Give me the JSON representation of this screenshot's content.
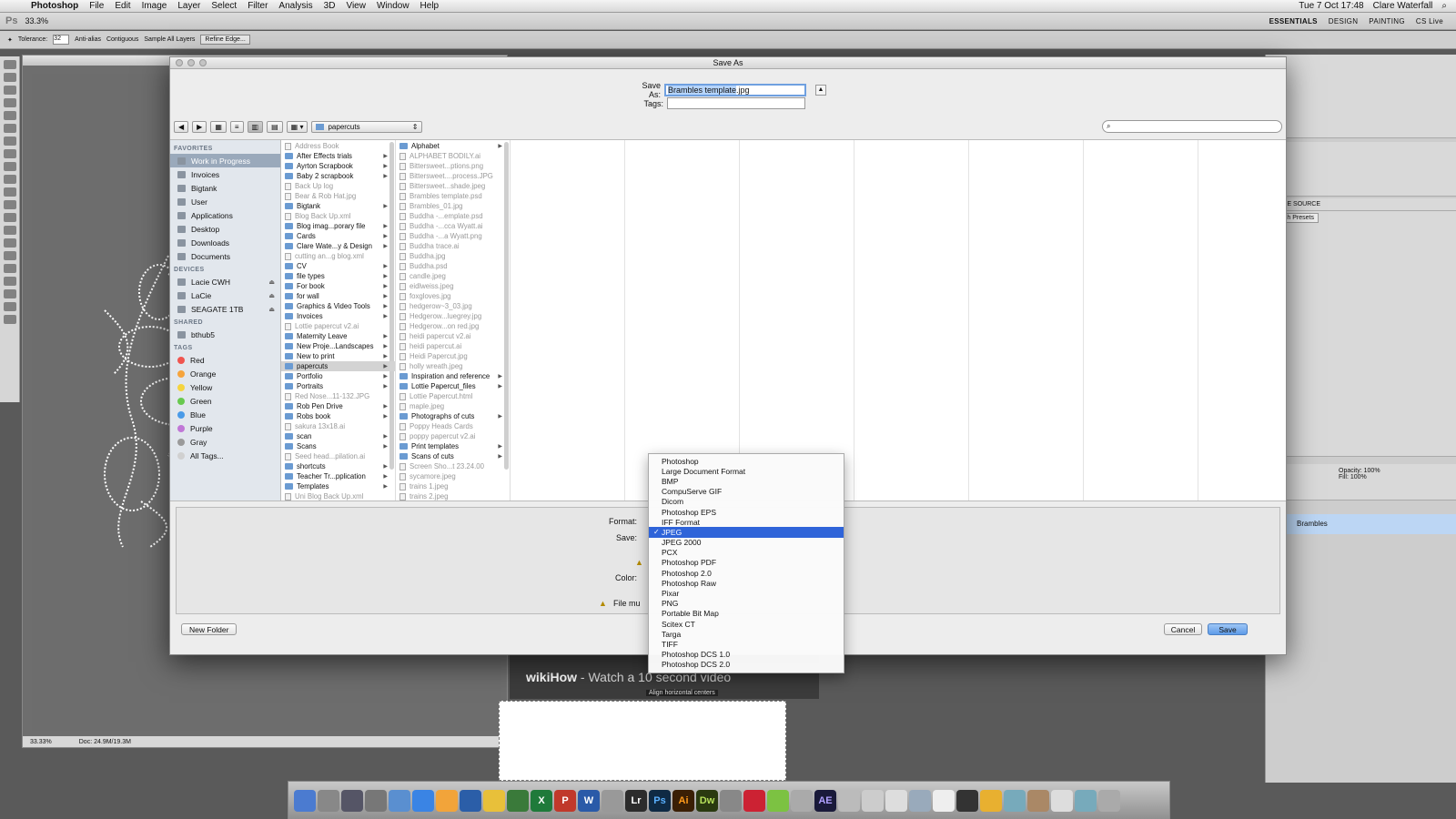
{
  "menubar": {
    "app": "Photoshop",
    "items": [
      "File",
      "Edit",
      "Image",
      "Layer",
      "Select",
      "Filter",
      "Analysis",
      "3D",
      "View",
      "Window",
      "Help"
    ],
    "clock": "Tue 7 Oct  17:48",
    "user": "Clare Waterfall"
  },
  "appbar": {
    "logo": "Ps",
    "zoom": "33.3%",
    "workspaces": [
      "ESSENTIALS",
      "DESIGN",
      "PAINTING"
    ],
    "cslive": "CS Live"
  },
  "optbar": {
    "tolerance_label": "Tolerance:",
    "tolerance_value": "32",
    "antialias": "Anti-alias",
    "contiguous": "Contiguous",
    "sample_all": "Sample All Layers",
    "refine": "Refine Edge..."
  },
  "docwin": {
    "zoom": "33.33%",
    "doc": "Doc: 24.9M/19.3M"
  },
  "rpanels": {
    "clone_source": "CLONE SOURCE",
    "brush_presets": "Brush Presets",
    "opacity_label": "Opacity:",
    "opacity_value": "100%",
    "fill_label": "Fill:",
    "fill_value": "100%",
    "layer_name": "Brambles"
  },
  "wiki": {
    "brand": "wikiHow",
    "text": " - Watch a 10 second video",
    "tooltip": "Align horizontal centers"
  },
  "dialog": {
    "title": "Save As",
    "save_as_label": "Save As:",
    "save_as_name": "Brambles template",
    "save_as_ext": ".jpg",
    "tags_label": "Tags:",
    "path_popup": "papercuts",
    "format_label": "Format:",
    "save_label": "Save:",
    "color_label": "Color:",
    "file_must": "File mu",
    "new_folder": "New Folder",
    "cancel": "Cancel",
    "save": "Save"
  },
  "sidebar": {
    "favorites_header": "FAVORITES",
    "favorites": [
      "Work in Progress",
      "Invoices",
      "Bigtank",
      "User",
      "Applications",
      "Desktop",
      "Downloads",
      "Documents"
    ],
    "devices_header": "DEVICES",
    "devices": [
      "Lacie CWH",
      "LaCie",
      "SEAGATE 1TB"
    ],
    "shared_header": "SHARED",
    "shared": [
      "bthub5"
    ],
    "tags_header": "TAGS",
    "tags": [
      {
        "name": "Red",
        "color": "#f0554f"
      },
      {
        "name": "Orange",
        "color": "#f6a43c"
      },
      {
        "name": "Yellow",
        "color": "#f5d43f"
      },
      {
        "name": "Green",
        "color": "#68c94f"
      },
      {
        "name": "Blue",
        "color": "#4a9be8"
      },
      {
        "name": "Purple",
        "color": "#c077d6"
      },
      {
        "name": "Gray",
        "color": "#9a9a9a"
      },
      {
        "name": "All Tags...",
        "color": "#d0d0d0"
      }
    ]
  },
  "col1": [
    {
      "n": "Address Book",
      "t": "d",
      "dim": true
    },
    {
      "n": "After Effects trials",
      "t": "f"
    },
    {
      "n": "Ayrton Scrapbook",
      "t": "f"
    },
    {
      "n": "Baby 2 scrapbook",
      "t": "f"
    },
    {
      "n": "Back Up log",
      "t": "d",
      "dim": true
    },
    {
      "n": "Bear & Rob Hat.jpg",
      "t": "d",
      "dim": true
    },
    {
      "n": "Bigtank",
      "t": "f"
    },
    {
      "n": "Blog Back Up.xml",
      "t": "d",
      "dim": true
    },
    {
      "n": "Blog imag...porary file",
      "t": "f"
    },
    {
      "n": "Cards",
      "t": "f"
    },
    {
      "n": "Clare Wate...y & Design",
      "t": "f"
    },
    {
      "n": "cutting an...g blog.xml",
      "t": "d",
      "dim": true
    },
    {
      "n": "CV",
      "t": "f"
    },
    {
      "n": "file types",
      "t": "f"
    },
    {
      "n": "For book",
      "t": "f"
    },
    {
      "n": "for wall",
      "t": "f"
    },
    {
      "n": "Graphics & Video Tools",
      "t": "f"
    },
    {
      "n": "Invoices",
      "t": "f"
    },
    {
      "n": "Lottie papercut v2.ai",
      "t": "d",
      "dim": true
    },
    {
      "n": "Maternity Leave",
      "t": "f"
    },
    {
      "n": "New Proje...Landscapes",
      "t": "f"
    },
    {
      "n": "New to print",
      "t": "f"
    },
    {
      "n": "papercuts",
      "t": "f",
      "sel": true
    },
    {
      "n": "Portfolio",
      "t": "f"
    },
    {
      "n": "Portraits",
      "t": "f"
    },
    {
      "n": "Red Nose...11-132.JPG",
      "t": "d",
      "dim": true
    },
    {
      "n": "Rob Pen Drive",
      "t": "f"
    },
    {
      "n": "Robs book",
      "t": "f"
    },
    {
      "n": "sakura 13x18.ai",
      "t": "d",
      "dim": true
    },
    {
      "n": "scan",
      "t": "f"
    },
    {
      "n": "Scans",
      "t": "f"
    },
    {
      "n": "Seed head...pilation.ai",
      "t": "d",
      "dim": true
    },
    {
      "n": "shortcuts",
      "t": "f"
    },
    {
      "n": "Teacher Tr...pplication",
      "t": "f"
    },
    {
      "n": "Templates",
      "t": "f"
    },
    {
      "n": "Uni Blog Back Up.xml",
      "t": "d",
      "dim": true
    }
  ],
  "col2": [
    {
      "n": "Alphabet",
      "t": "f"
    },
    {
      "n": "ALPHABET BODILY.ai",
      "t": "d",
      "dim": true
    },
    {
      "n": "Bittersweet...ptions.png",
      "t": "d",
      "dim": true
    },
    {
      "n": "Bittersweet....process.JPG",
      "t": "d",
      "dim": true
    },
    {
      "n": "Bittersweet...shade.jpeg",
      "t": "d",
      "dim": true
    },
    {
      "n": "Brambles template.psd",
      "t": "d",
      "dim": true
    },
    {
      "n": "Brambles_01.jpg",
      "t": "d",
      "dim": true
    },
    {
      "n": "Buddha -...emplate.psd",
      "t": "d",
      "dim": true
    },
    {
      "n": "Buddha -...cca Wyatt.ai",
      "t": "d",
      "dim": true
    },
    {
      "n": "Buddha -...a Wyatt.png",
      "t": "d",
      "dim": true
    },
    {
      "n": "Buddha trace.ai",
      "t": "d",
      "dim": true
    },
    {
      "n": "Buddha.jpg",
      "t": "d",
      "dim": true
    },
    {
      "n": "Buddha.psd",
      "t": "d",
      "dim": true
    },
    {
      "n": "candle.jpeg",
      "t": "d",
      "dim": true
    },
    {
      "n": "eidlweiss.jpeg",
      "t": "d",
      "dim": true
    },
    {
      "n": "foxgloves.jpg",
      "t": "d",
      "dim": true
    },
    {
      "n": "hedgerow~3_03.jpg",
      "t": "d",
      "dim": true
    },
    {
      "n": "Hedgerow...luegrey.jpg",
      "t": "d",
      "dim": true
    },
    {
      "n": "Hedgerow...on red.jpg",
      "t": "d",
      "dim": true
    },
    {
      "n": "heidi papercut v2.ai",
      "t": "d",
      "dim": true
    },
    {
      "n": "heidi papercut.ai",
      "t": "d",
      "dim": true
    },
    {
      "n": "Heidi Papercut.jpg",
      "t": "d",
      "dim": true
    },
    {
      "n": "holly wreath.jpeg",
      "t": "d",
      "dim": true
    },
    {
      "n": "Inspiration and reference",
      "t": "f"
    },
    {
      "n": "Lottie Papercut_files",
      "t": "f"
    },
    {
      "n": "Lottie Papercut.html",
      "t": "d",
      "dim": true
    },
    {
      "n": "maple.jpeg",
      "t": "d",
      "dim": true
    },
    {
      "n": "Photographs of cuts",
      "t": "f"
    },
    {
      "n": "Poppy Heads Cards",
      "t": "d",
      "dim": true
    },
    {
      "n": "poppy papercut v2.ai",
      "t": "d",
      "dim": true
    },
    {
      "n": "Print templates",
      "t": "f"
    },
    {
      "n": "Scans of cuts",
      "t": "f"
    },
    {
      "n": "Screen Sho...t 23.24.00",
      "t": "d",
      "dim": true
    },
    {
      "n": "sycamore.jpeg",
      "t": "d",
      "dim": true
    },
    {
      "n": "trains 1.jpeg",
      "t": "d",
      "dim": true
    },
    {
      "n": "trains 2.jpeg",
      "t": "d",
      "dim": true
    }
  ],
  "format_menu": {
    "selected": "JPEG",
    "options": [
      "Photoshop",
      "Large Document Format",
      "BMP",
      "CompuServe GIF",
      "Dicom",
      "Photoshop EPS",
      "IFF Format",
      "JPEG",
      "JPEG 2000",
      "PCX",
      "Photoshop PDF",
      "Photoshop 2.0",
      "Photoshop Raw",
      "Pixar",
      "PNG",
      "Portable Bit Map",
      "Scitex CT",
      "Targa",
      "TIFF",
      "Photoshop DCS 1.0",
      "Photoshop DCS 2.0"
    ]
  },
  "dock": {
    "labels": [
      "Lr",
      "Ps",
      "Ai",
      "Dw",
      "AE",
      "W",
      "X",
      "P"
    ]
  }
}
